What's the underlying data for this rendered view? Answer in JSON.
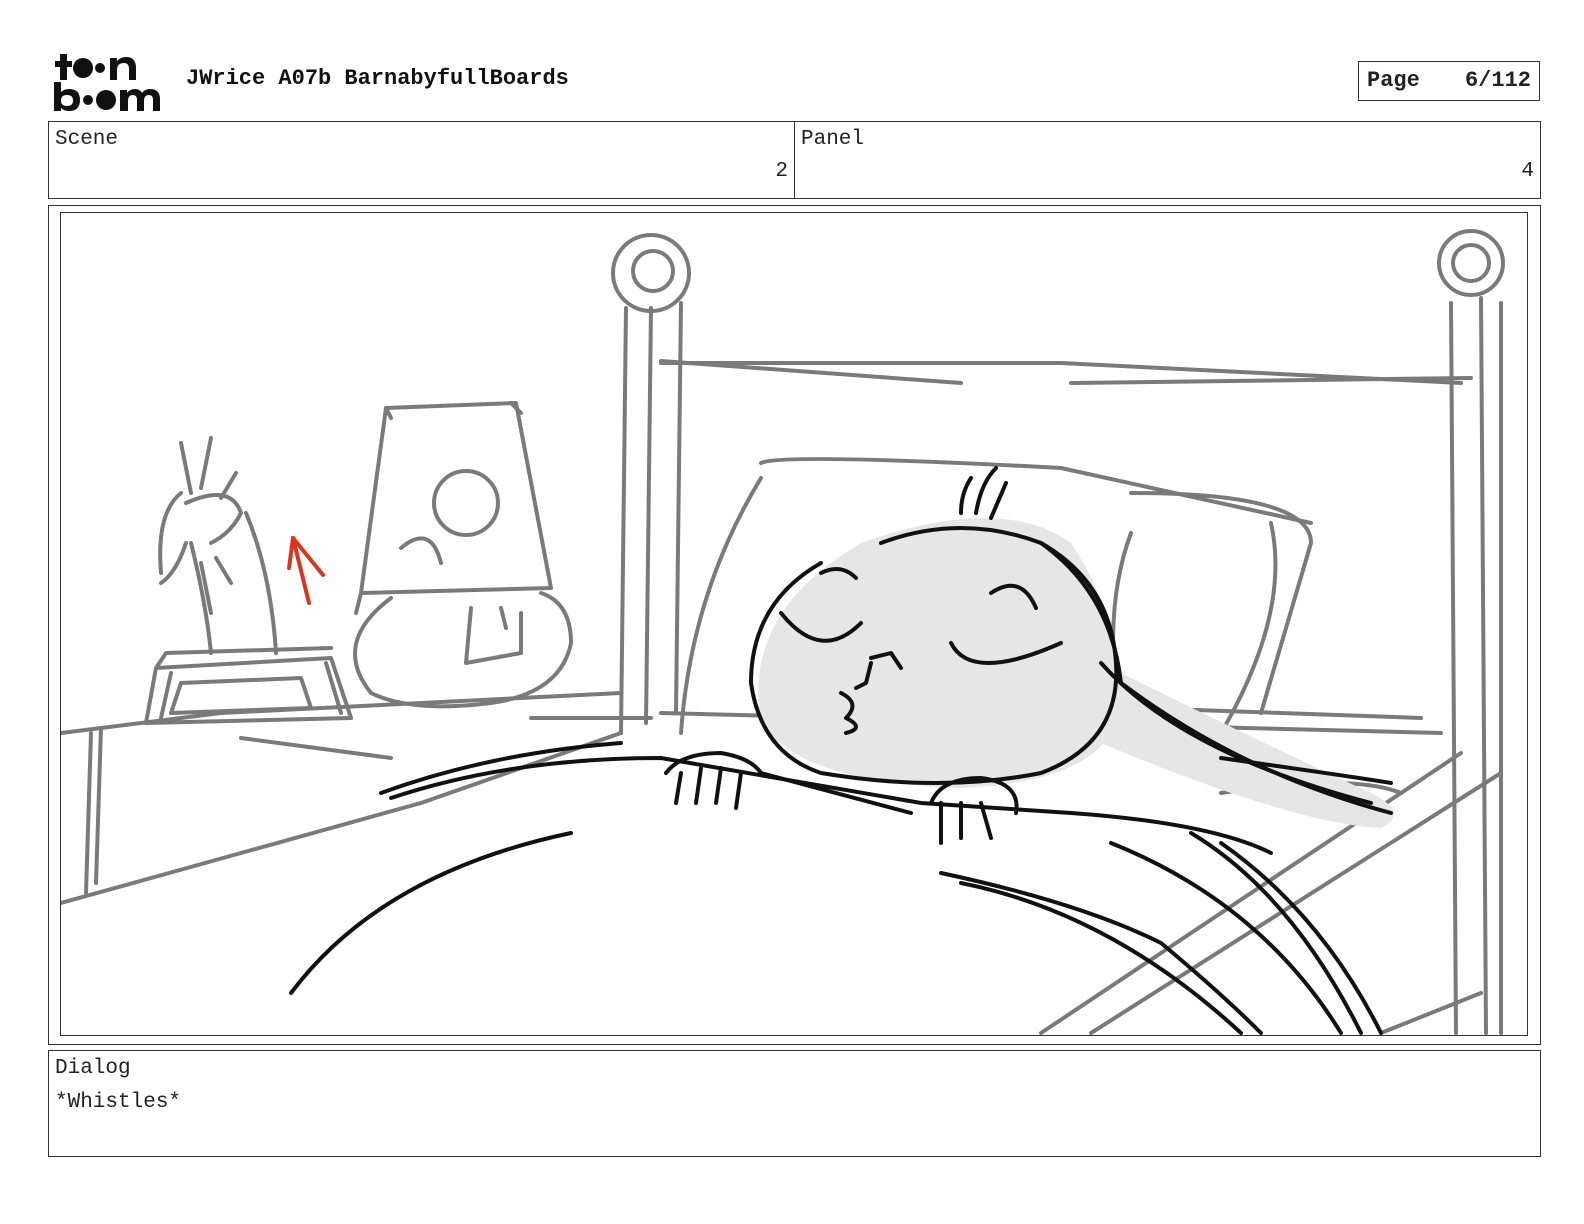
{
  "header": {
    "logo_text": "toon boom",
    "logo_icon": "toon-boom-logo",
    "project_title": "JWrice A07b BarnabyfullBoards",
    "page_label": "Page",
    "page_value": "6/112"
  },
  "info": {
    "scene_label": "Scene",
    "scene_value": "2",
    "panel_label": "Panel",
    "panel_value": "4"
  },
  "sketch": {
    "description_icon": "storyboard-sketch-image",
    "stroke_color": "#7a7a7a",
    "ink_color": "#111111",
    "accent_color": "#d9361e",
    "fill_color": "#e6e6e6"
  },
  "dialog": {
    "label": "Dialog",
    "text": "*Whistles*"
  }
}
